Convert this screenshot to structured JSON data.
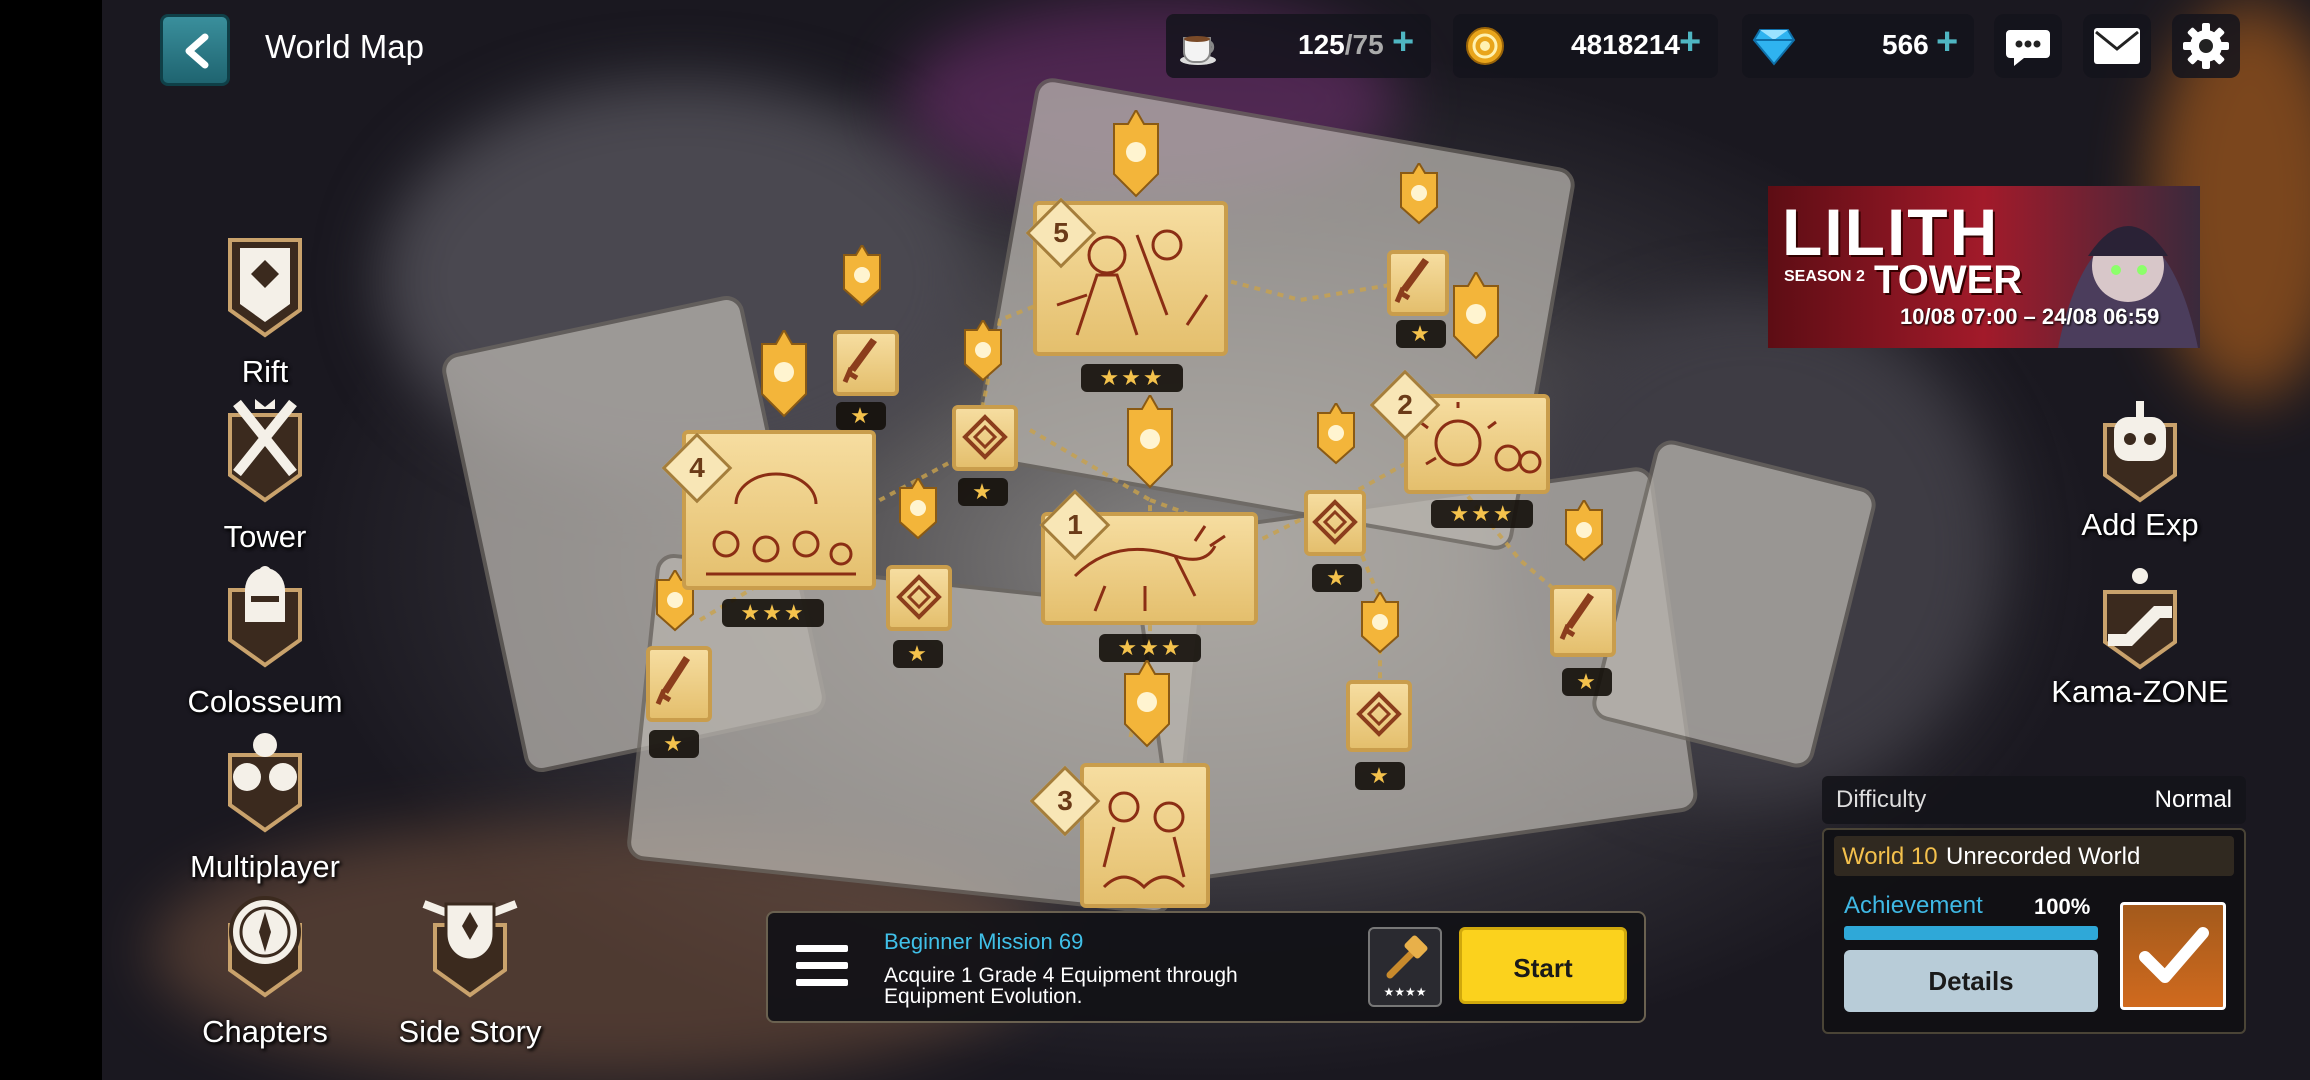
{
  "header": {
    "title": "World Map"
  },
  "resources": {
    "stamina": {
      "current": "125",
      "max": "/75"
    },
    "gold": {
      "value": "4818214"
    },
    "gems": {
      "value": "566"
    }
  },
  "menu": {
    "rift": "Rift",
    "tower": "Tower",
    "colosseum": "Colosseum",
    "multiplayer": "Multiplayer",
    "chapters": "Chapters",
    "side_story": "Side Story"
  },
  "promo": {
    "title_line1": "LILITH",
    "season": "SEASON 2",
    "title_line2": "TOWER",
    "dates": "10/08 07:00 – 24/08 06:59"
  },
  "side_buttons": {
    "add_exp": "Add Exp",
    "kama_zone": "Kama-ZONE"
  },
  "difficulty": {
    "label": "Difficulty",
    "value": "Normal"
  },
  "world": {
    "number": "World 10",
    "name": "Unrecorded World",
    "achievement_label": "Achievement",
    "achievement_value": "100%",
    "achievement_fraction": 1.0,
    "details_label": "Details"
  },
  "mission": {
    "title": "Beginner Mission 69",
    "desc_line1": "Acquire 1 Grade 4 Equipment through",
    "desc_line2": "Equipment Evolution.",
    "reward_stars": "★★★★",
    "start_label": "Start"
  },
  "stages": {
    "s1": {
      "num": "1",
      "stars": "★★★"
    },
    "s2": {
      "num": "2",
      "stars": "★★★"
    },
    "s3": {
      "num": "3"
    },
    "s4": {
      "num": "4",
      "stars": "★★★"
    },
    "s5": {
      "num": "5",
      "stars": "★★★"
    },
    "star_single": "★"
  },
  "colors": {
    "accent": "#fbd21d",
    "teal": "#2a7e8a",
    "card": "#f0d08a",
    "progress": "#2fa8d8"
  }
}
